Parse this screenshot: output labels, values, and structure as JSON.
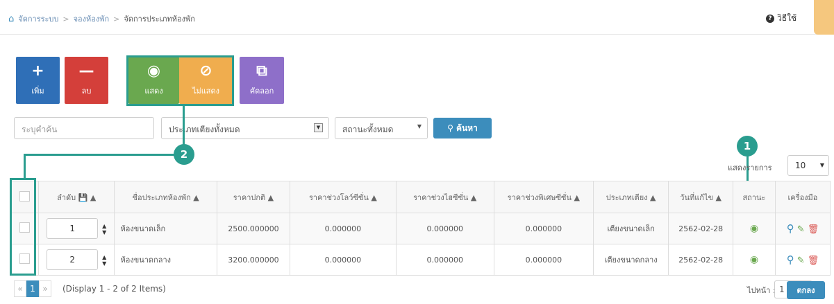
{
  "breadcrumb": {
    "items": [
      "จัดการระบบ",
      "จองห้องพัก",
      "จัดการประเภทห้องพัก"
    ],
    "separator": ">"
  },
  "help": {
    "label": "วิธีใช้"
  },
  "toolbar": {
    "add_label": "เพิ่ม",
    "delete_label": "ลบ",
    "show_label": "แสดง",
    "hide_label": "ไม่แสดง",
    "copy_label": "คัดลอก"
  },
  "filters": {
    "search_placeholder": "ระบุคำค้น",
    "bed_type": "ประเภทเตียงทั้งหมด",
    "status": "สถานะทั้งหมด",
    "search_button": "ค้นหา"
  },
  "callouts": {
    "one": "1",
    "two": "2"
  },
  "per_page": {
    "label": "แสดงรายการ",
    "value": "10"
  },
  "table": {
    "headers": {
      "order": "ลำดับ",
      "name": "ชื่อประเภทห้องพัก",
      "price": "ราคาปกติ",
      "low_price": "ราคาช่วงโลว์ซีซั่น",
      "high_price": "ราคาช่วงไฮซีซั่น",
      "special_price": "ราคาช่วงพิเศษซีซั่น",
      "bed_type": "ประเภทเตียง",
      "updated": "วันที่แก้ไข",
      "status": "สถานะ",
      "tools": "เครื่องมือ"
    },
    "rows": [
      {
        "order": "1",
        "name": "ห้องขนาดเล็ก",
        "price": "2500.000000",
        "low_price": "0.000000",
        "high_price": "0.000000",
        "special_price": "0.000000",
        "bed_type": "เตียงขนาดเล็ก",
        "updated": "2562-02-28"
      },
      {
        "order": "2",
        "name": "ห้องขนาดกลาง",
        "price": "3200.000000",
        "low_price": "0.000000",
        "high_price": "0.000000",
        "special_price": "0.000000",
        "bed_type": "เตียงขนาดกลาง",
        "updated": "2562-02-28"
      }
    ]
  },
  "pagination": {
    "prev": "«",
    "current": "1",
    "next": "»",
    "info": "(Display 1 - 2 of 2 Items)",
    "goto_label": "ไปหน้า :",
    "goto_value": "1",
    "goto_button": "ตกลง"
  },
  "colors": {
    "primary": "#3c8dbc",
    "add": "#2f6fb7",
    "delete": "#d43f3a",
    "show": "#6aa84f",
    "hide": "#f0ad4e",
    "copy": "#8e6fc9",
    "callout": "#2a9d8f"
  }
}
